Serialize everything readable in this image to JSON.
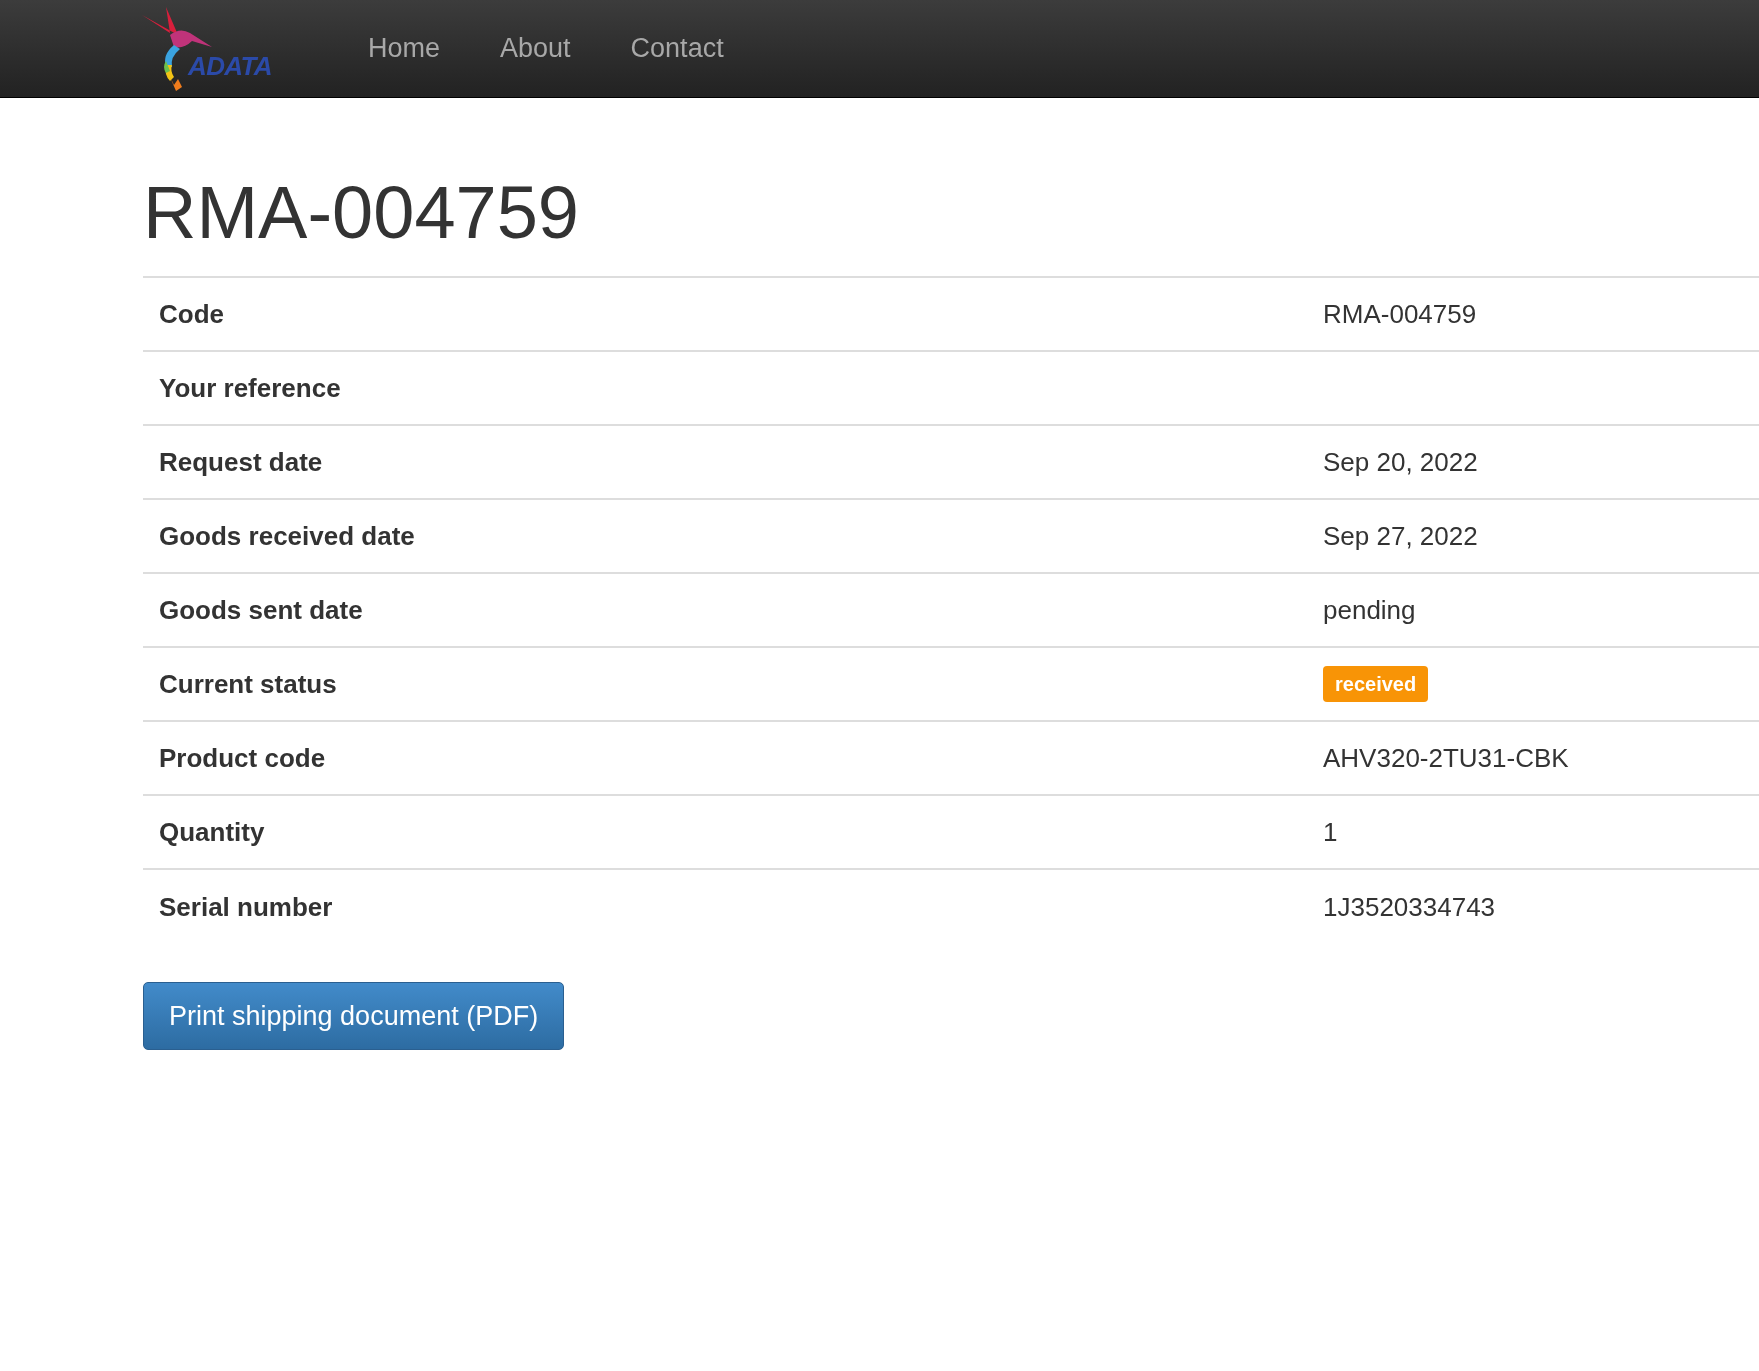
{
  "navbar": {
    "logo_text": "ADATA",
    "links": [
      {
        "label": "Home"
      },
      {
        "label": "About"
      },
      {
        "label": "Contact"
      }
    ]
  },
  "title": "RMA-004759",
  "details": [
    {
      "label": "Code",
      "value": "RMA-004759",
      "kind": "text"
    },
    {
      "label": "Your reference",
      "kind": "text"
    },
    {
      "label": "Request date",
      "value": "Sep 20, 2022",
      "kind": "text"
    },
    {
      "label": "Goods received date",
      "value": "Sep 27, 2022",
      "kind": "text"
    },
    {
      "label": "Goods sent date",
      "value": "pending",
      "kind": "text"
    },
    {
      "label": "Current status",
      "value": "received",
      "kind": "badge",
      "color": "#f89406"
    },
    {
      "label": "Product code",
      "value": "AHV320-2TU31-CBK",
      "kind": "text"
    },
    {
      "label": "Quantity",
      "value": "1",
      "kind": "text"
    },
    {
      "label": "Serial number",
      "value": "1J3520334743",
      "kind": "text"
    }
  ],
  "print_button": "Print shipping document (PDF)"
}
